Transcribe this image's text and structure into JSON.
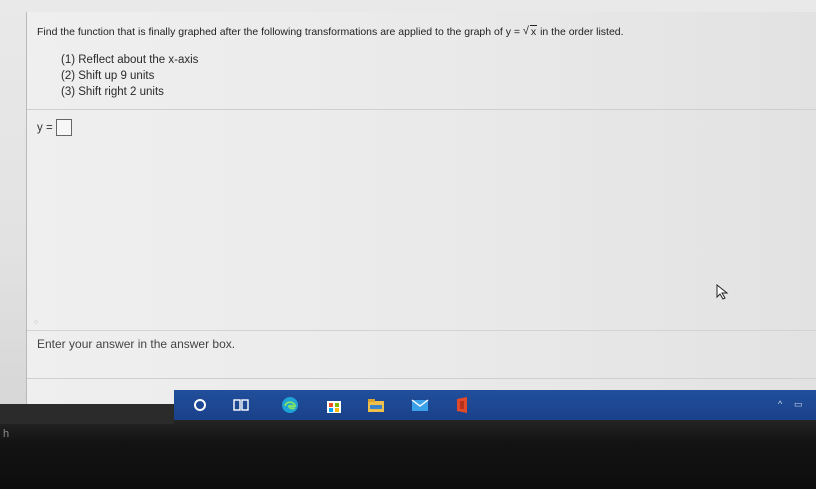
{
  "question": {
    "text_before": "Find the function that is finally graphed after the following transformations are applied to the graph of y =",
    "radical_symbol": "√",
    "radicand": "x",
    "text_after": "in the order listed."
  },
  "steps": [
    "(1)  Reflect about the x-axis",
    "(2)  Shift up 9 units",
    "(3)  Shift right 2 units"
  ],
  "answer": {
    "label": "y =",
    "value": ""
  },
  "hint": "Enter your answer in the answer box.",
  "taskbar": {
    "icons": [
      "cortana-circle-icon",
      "task-view-icon",
      "edge-icon",
      "store-icon",
      "file-explorer-icon",
      "mail-icon",
      "office-icon"
    ],
    "tray": {
      "chevron": "^",
      "battery": "▭"
    }
  },
  "edge_letter": "h"
}
